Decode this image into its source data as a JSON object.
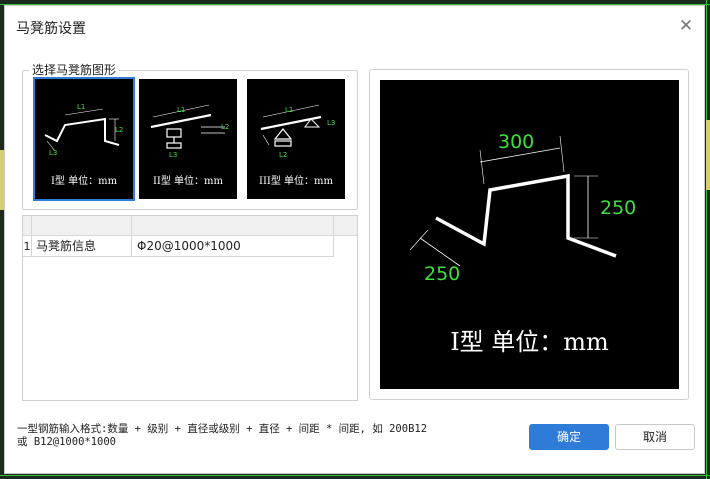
{
  "window": {
    "title": "马凳筋设置"
  },
  "shape_group": {
    "label": "选择马凳筋图形",
    "shapes": [
      {
        "caption": "I型 单位：mm",
        "labels": [
          "L1",
          "L2",
          "L3"
        ],
        "selected": true
      },
      {
        "caption": "II型 单位：mm",
        "labels": [
          "L1",
          "L2",
          "L3"
        ],
        "selected": false
      },
      {
        "caption": "III型 单位：mm",
        "labels": [
          "L1",
          "L2",
          "L3"
        ],
        "selected": false
      }
    ]
  },
  "grid": {
    "rows": [
      {
        "num": "1",
        "name": "马凳筋信息",
        "value": "Φ20@1000*1000"
      }
    ]
  },
  "preview": {
    "caption": "I型 单位：mm",
    "dims": {
      "top": "300",
      "right": "250",
      "left": "250"
    }
  },
  "hint": "一型钢筋输入格式:数量 + 级别 + 直径或级别 + 直径 + 间距 * 间距, 如 200B12\n或 B12@1000*1000",
  "buttons": {
    "ok": "确定",
    "cancel": "取消"
  },
  "colors": {
    "accent": "#2e7bd8",
    "dimension_green": "#3de03d"
  }
}
